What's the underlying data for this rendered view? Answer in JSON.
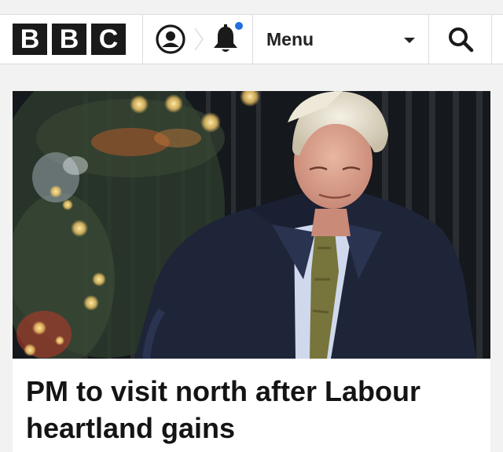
{
  "header": {
    "logo_letters": [
      "B",
      "B",
      "C"
    ],
    "account_icon": "account-icon",
    "notification_icon": "bell-icon",
    "notification_dot_color": "#1f6fe0",
    "menu_label": "Menu",
    "search_icon": "search-icon"
  },
  "story": {
    "headline": "PM to visit north after Labour heartland gains"
  },
  "colors": {
    "background": "#f2f2f2",
    "logo_block": "#1a1a1a",
    "headline_text": "#141414"
  }
}
